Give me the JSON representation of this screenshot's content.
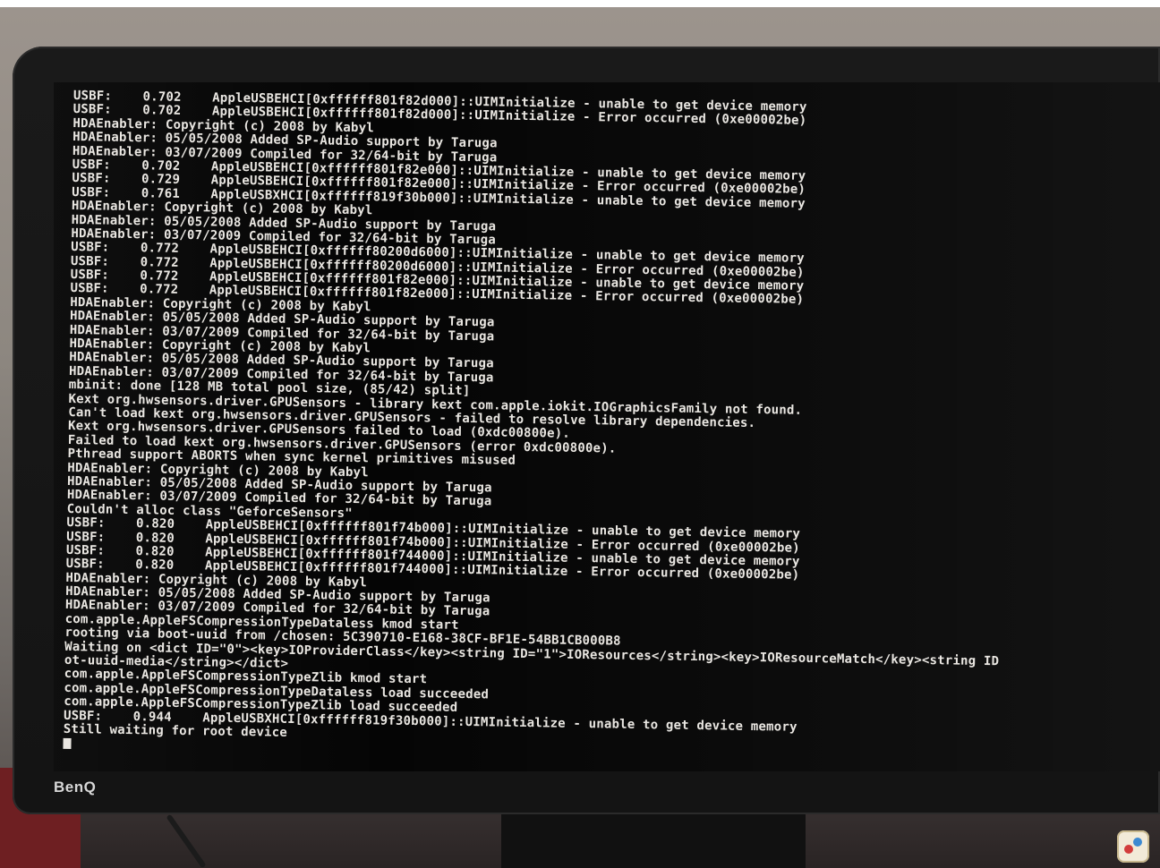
{
  "monitor": {
    "brand": "BenQ"
  },
  "console": {
    "lines": [
      "USBF:    0.702    AppleUSBEHCI[0xffffff801f82d000]::UIMInitialize - unable to get device memory",
      "USBF:    0.702    AppleUSBEHCI[0xffffff801f82d000]::UIMInitialize - Error occurred (0xe00002be)",
      "HDAEnabler: Copyright (c) 2008 by Kabyl",
      "HDAEnabler: 05/05/2008 Added SP-Audio support by Taruga",
      "HDAEnabler: 03/07/2009 Compiled for 32/64-bit by Taruga",
      "USBF:    0.702    AppleUSBEHCI[0xffffff801f82e000]::UIMInitialize - unable to get device memory",
      "USBF:    0.729    AppleUSBEHCI[0xffffff801f82e000]::UIMInitialize - Error occurred (0xe00002be)",
      "USBF:    0.761    AppleUSBXHCI[0xffffff819f30b000]::UIMInitialize - unable to get device memory",
      "HDAEnabler: Copyright (c) 2008 by Kabyl",
      "HDAEnabler: 05/05/2008 Added SP-Audio support by Taruga",
      "HDAEnabler: 03/07/2009 Compiled for 32/64-bit by Taruga",
      "USBF:    0.772    AppleUSBEHCI[0xffffff80200d6000]::UIMInitialize - unable to get device memory",
      "USBF:    0.772    AppleUSBEHCI[0xffffff80200d6000]::UIMInitialize - Error occurred (0xe00002be)",
      "USBF:    0.772    AppleUSBEHCI[0xffffff801f82e000]::UIMInitialize - unable to get device memory",
      "USBF:    0.772    AppleUSBEHCI[0xffffff801f82e000]::UIMInitialize - Error occurred (0xe00002be)",
      "HDAEnabler: Copyright (c) 2008 by Kabyl",
      "HDAEnabler: 05/05/2008 Added SP-Audio support by Taruga",
      "HDAEnabler: 03/07/2009 Compiled for 32/64-bit by Taruga",
      "HDAEnabler: Copyright (c) 2008 by Kabyl",
      "HDAEnabler: 05/05/2008 Added SP-Audio support by Taruga",
      "HDAEnabler: 03/07/2009 Compiled for 32/64-bit by Taruga",
      "mbinit: done [128 MB total pool size, (85/42) split]",
      "Kext org.hwsensors.driver.GPUSensors - library kext com.apple.iokit.IOGraphicsFamily not found.",
      "Can't load kext org.hwsensors.driver.GPUSensors - failed to resolve library dependencies.",
      "Kext org.hwsensors.driver.GPUSensors failed to load (0xdc00800e).",
      "Failed to load kext org.hwsensors.driver.GPUSensors (error 0xdc00800e).",
      "Pthread support ABORTS when sync kernel primitives misused",
      "HDAEnabler: Copyright (c) 2008 by Kabyl",
      "HDAEnabler: 05/05/2008 Added SP-Audio support by Taruga",
      "HDAEnabler: 03/07/2009 Compiled for 32/64-bit by Taruga",
      "Couldn't alloc class \"GeforceSensors\"",
      "USBF:    0.820    AppleUSBEHCI[0xffffff801f74b000]::UIMInitialize - unable to get device memory",
      "USBF:    0.820    AppleUSBEHCI[0xffffff801f74b000]::UIMInitialize - Error occurred (0xe00002be)",
      "USBF:    0.820    AppleUSBEHCI[0xffffff801f744000]::UIMInitialize - unable to get device memory",
      "USBF:    0.820    AppleUSBEHCI[0xffffff801f744000]::UIMInitialize - Error occurred (0xe00002be)",
      "HDAEnabler: Copyright (c) 2008 by Kabyl",
      "HDAEnabler: 05/05/2008 Added SP-Audio support by Taruga",
      "HDAEnabler: 03/07/2009 Compiled for 32/64-bit by Taruga",
      "com.apple.AppleFSCompressionTypeDataless kmod start",
      "rooting via boot-uuid from /chosen: 5C390710-E168-38CF-BF1E-54BB1CB000B8",
      "Waiting on <dict ID=\"0\"><key>IOProviderClass</key><string ID=\"1\">IOResources</string><key>IOResourceMatch</key><string ID",
      "ot-uuid-media</string></dict>",
      "com.apple.AppleFSCompressionTypeZlib kmod start",
      "com.apple.AppleFSCompressionTypeDataless load succeeded",
      "com.apple.AppleFSCompressionTypeZlib load succeeded",
      "USBF:    0.944    AppleUSBXHCI[0xffffff819f30b000]::UIMInitialize - unable to get device memory",
      "Still waiting for root device"
    ]
  },
  "colors": {
    "console_text": "#e9e6e1",
    "screen_background": "#050505",
    "bezel": "#1a1a1a"
  },
  "icons": {
    "corner_watermark": "app-badge-icon"
  }
}
